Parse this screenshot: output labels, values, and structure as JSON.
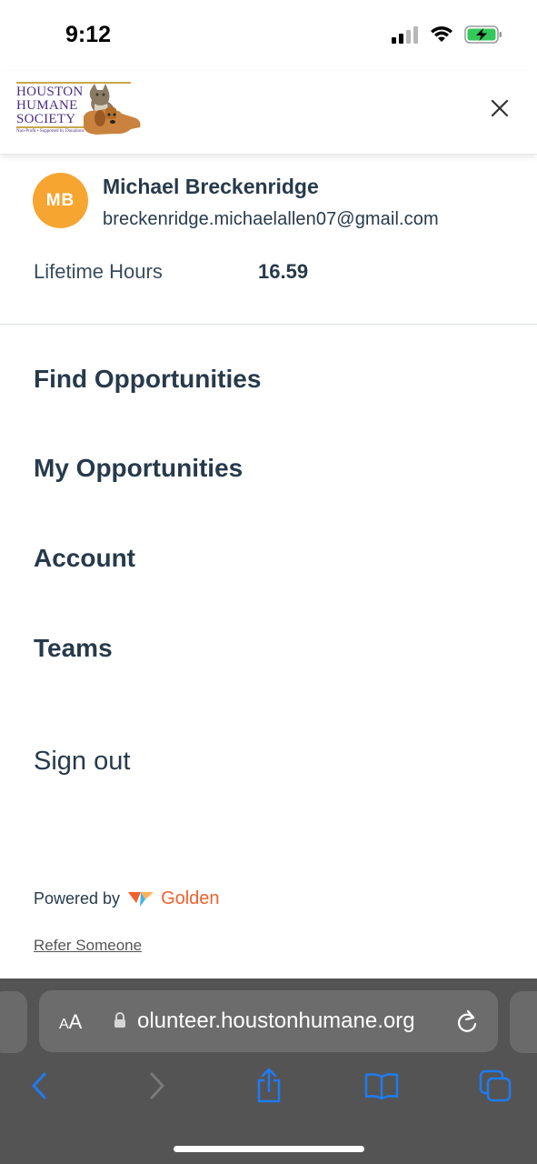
{
  "status_bar": {
    "time": "9:12",
    "icons": [
      "signal-icon",
      "wifi-icon",
      "battery-charging-icon"
    ]
  },
  "header": {
    "logo": {
      "line1": "HOUSTON",
      "line2": "HUMANE",
      "line3": "SOCIETY",
      "tagline": "Non-Profit • Supported by Donations"
    },
    "close_icon": "close-icon"
  },
  "profile": {
    "initials": "MB",
    "name": "Michael Breckenridge",
    "email": "breckenridge.michaelallen07@gmail.com",
    "hours_label": "Lifetime Hours",
    "hours_value": "16.59",
    "avatar_color": "#f7a531"
  },
  "menu": {
    "items": [
      {
        "label": "Find Opportunities"
      },
      {
        "label": "My Opportunities"
      },
      {
        "label": "Account"
      },
      {
        "label": "Teams"
      }
    ],
    "signout": "Sign out"
  },
  "footer": {
    "powered_by": "Powered by",
    "brand": "Golden",
    "brand_color": "#f0612e",
    "refer": "Refer Someone"
  },
  "browser": {
    "aa_small": "A",
    "aa_big": "A",
    "url": "olunteer.houstonhumane.org",
    "toolbar": [
      "back-icon",
      "forward-icon",
      "share-icon",
      "bookmarks-icon",
      "tabs-icon"
    ]
  },
  "colors": {
    "text": "#273a4b",
    "safari_bg": "#545454",
    "ios_blue": "#1e7cf2"
  }
}
